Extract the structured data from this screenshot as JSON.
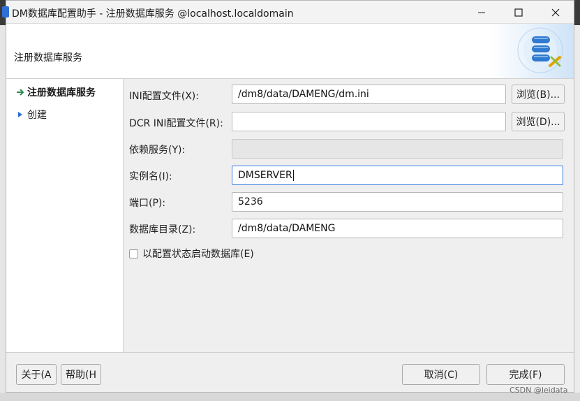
{
  "window": {
    "title": "DM数据库配置助手 - 注册数据库服务 @localhost.localdomain",
    "controls": {
      "minimize": "minimize-icon",
      "maximize": "maximize-icon",
      "close": "close-icon"
    }
  },
  "header": {
    "title": "注册数据库服务",
    "art_icon": "database-icon"
  },
  "nav": {
    "items": [
      {
        "label": "注册数据库服务",
        "icon": "arrow-right-icon",
        "active": true
      },
      {
        "label": "创建",
        "icon": "triangle-right-icon",
        "active": false
      }
    ]
  },
  "form": {
    "ini_label": "INI配置文件(X):",
    "ini_value": "/dm8/data/DAMENG/dm.ini",
    "ini_browse": "浏览(B)...",
    "dcr_label": "DCR INI配置文件(R):",
    "dcr_value": "",
    "dcr_browse": "浏览(D)...",
    "dep_label": "依赖服务(Y):",
    "dep_value": "",
    "instance_label": "实例名(I):",
    "instance_value": "DMSERVER",
    "port_label": "端口(P):",
    "port_value": "5236",
    "dir_label": "数据库目录(Z):",
    "dir_value": "/dm8/data/DAMENG",
    "checkbox_label": "以配置状态启动数据库(E)"
  },
  "footer": {
    "about": "关于(A",
    "help": "帮助(H",
    "cancel": "取消(C)",
    "finish": "完成(F)"
  },
  "watermark": "CSDN @leidata",
  "colors": {
    "accent": "#3b7ddd",
    "nav_arrow": "#2e8b57",
    "nav_triangle": "#2f6fd6"
  }
}
